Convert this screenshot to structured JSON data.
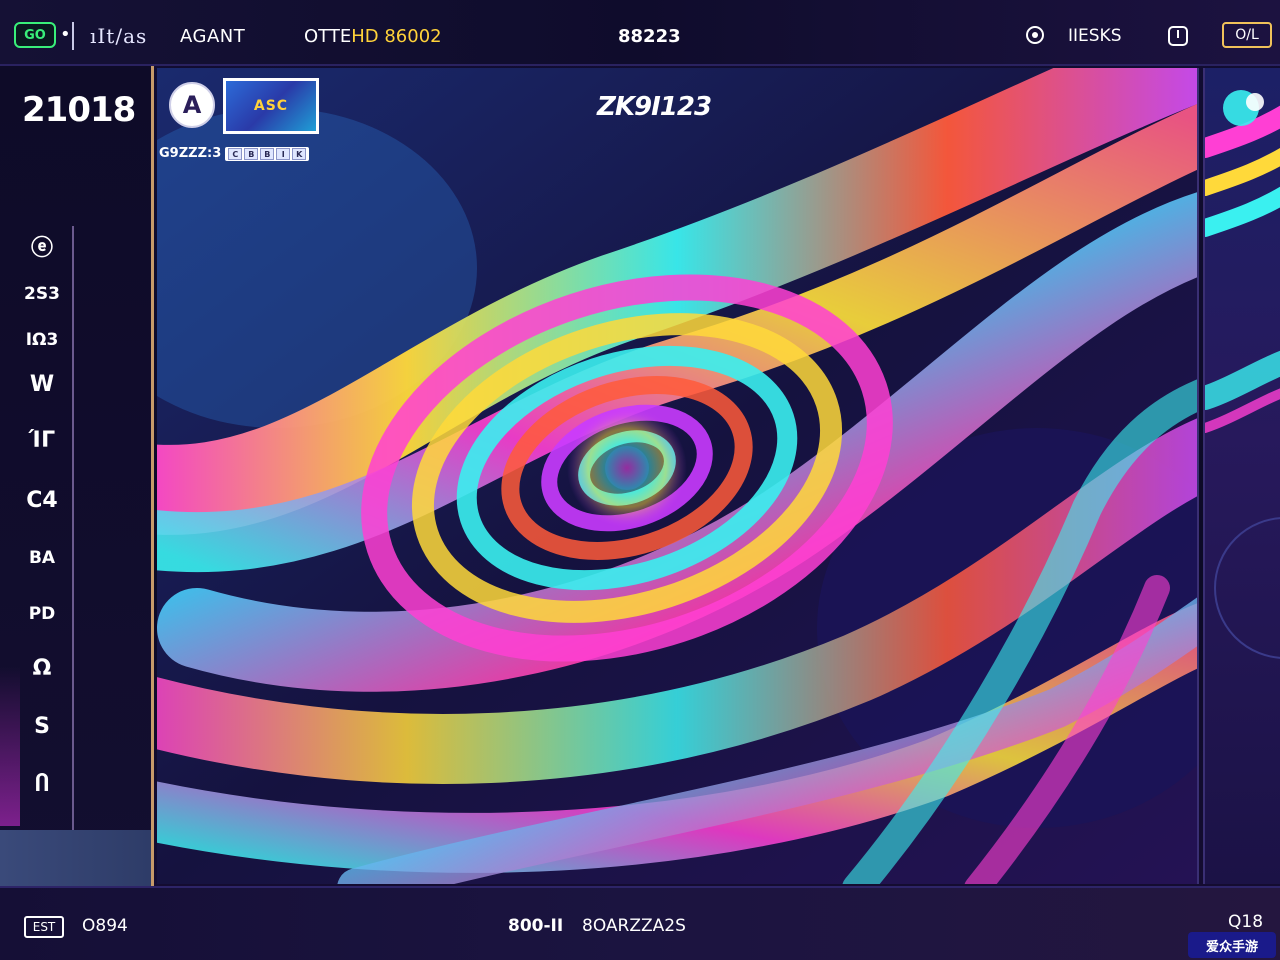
{
  "topbar": {
    "logo_text": "GO",
    "dot": "•",
    "ithas_label": "ıIt/as",
    "agant_label": "AGANT",
    "other_prefix": "OTTE",
    "other_highlight": "HD 86002",
    "center_value": "88223",
    "tasks_label": "IIESKS",
    "switch_label": "O/L"
  },
  "sidebar": {
    "big_number": "21018",
    "items": [
      {
        "label": "ⓔ",
        "kind": "icon"
      },
      {
        "label": "2S3",
        "kind": "text"
      },
      {
        "label": "IΩ3",
        "kind": "text"
      },
      {
        "label": "W",
        "kind": "icon"
      },
      {
        "label": "ΊΓ",
        "kind": "icon"
      },
      {
        "label": "C4",
        "kind": "icon"
      },
      {
        "label": "BA",
        "kind": "text"
      },
      {
        "label": "PD",
        "kind": "text"
      },
      {
        "label": "Ω",
        "kind": "icon"
      },
      {
        "label": "S",
        "kind": "icon"
      },
      {
        "label": "Ⴖ",
        "kind": "icon"
      }
    ]
  },
  "canvas": {
    "avatar_glyph": "A",
    "thumb_label": "ASC",
    "caption": "G9ZZZ:3",
    "caption_keys": [
      "C",
      "B",
      "B",
      "I",
      "K"
    ],
    "title": "ZK9I123"
  },
  "bottombar": {
    "badge": "EST",
    "left_label": "O894",
    "center_value": "800-II",
    "center_label": "8OARZZA2S",
    "right_value": "Q18",
    "watermark": "爱众手游"
  },
  "colors": {
    "accent_gold": "#ffd23a",
    "accent_green": "#39f07a",
    "sidebar_border": "#c79b6a",
    "background": "#0d0a26"
  }
}
